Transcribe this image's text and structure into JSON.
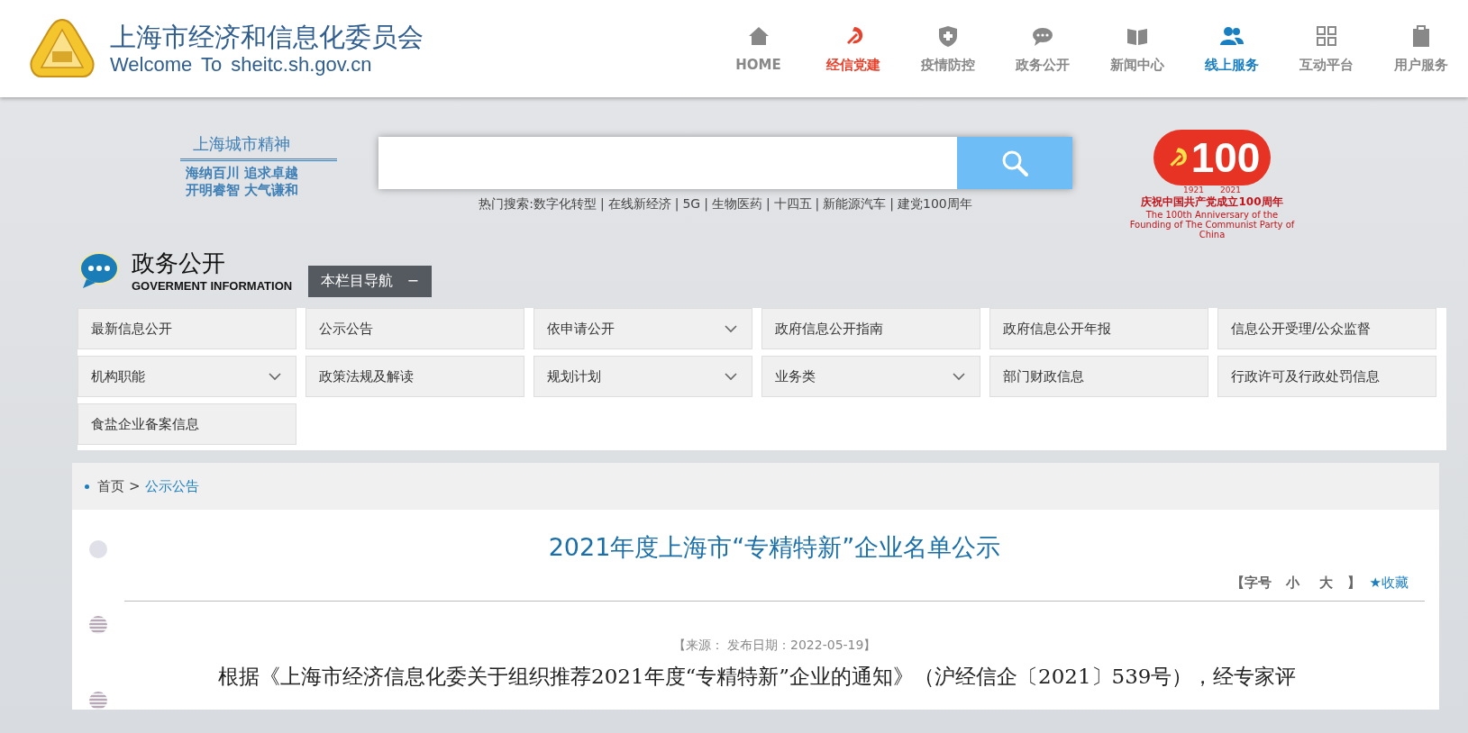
{
  "header": {
    "title": "上海市经济和信息化委员会",
    "subtitle": "Welcome To sheitc.sh.gov.cn"
  },
  "nav": [
    {
      "label": "HOME",
      "color": "#888888"
    },
    {
      "label": "经信党建",
      "color": "#e8412c"
    },
    {
      "label": "疫情防控",
      "color": "#888888"
    },
    {
      "label": "政务公开",
      "color": "#888888"
    },
    {
      "label": "新闻中心",
      "color": "#888888"
    },
    {
      "label": "线上服务",
      "color": "#1a7fc1"
    },
    {
      "label": "互动平台",
      "color": "#888888"
    },
    {
      "label": "用户服务",
      "color": "#888888"
    }
  ],
  "motto": {
    "title": "上海城市精神",
    "lines": [
      "海纳百川 追求卓越",
      "开明睿智 大气谦和"
    ]
  },
  "search": {
    "hot_label": "热门搜索:",
    "separator": "|",
    "hot_terms": [
      "数字化转型",
      "在线新经济",
      "5G",
      "生物医药",
      "十四五",
      "新能源汽车",
      "建党100周年"
    ]
  },
  "anniversary": {
    "number": "100",
    "years": [
      "1921",
      "2021"
    ],
    "caption": "庆祝中国共产党成立100周年",
    "english": "The 100th Anniversary of the Founding of The Communist Party of China"
  },
  "section": {
    "title": "政务公开",
    "subtitle": "GOVERMENT INFORMATION",
    "nav_button": "本栏目导航",
    "toggle": "−"
  },
  "menu": [
    {
      "label": "最新信息公开",
      "expandable": false
    },
    {
      "label": "公示公告",
      "expandable": false
    },
    {
      "label": "依申请公开",
      "expandable": true
    },
    {
      "label": "政府信息公开指南",
      "expandable": false
    },
    {
      "label": "政府信息公开年报",
      "expandable": false
    },
    {
      "label": "信息公开受理/公众监督",
      "expandable": false
    },
    {
      "label": "机构职能",
      "expandable": true
    },
    {
      "label": "政策法规及解读",
      "expandable": false
    },
    {
      "label": "规划计划",
      "expandable": true
    },
    {
      "label": "业务类",
      "expandable": true
    },
    {
      "label": "部门财政信息",
      "expandable": false
    },
    {
      "label": "行政许可及行政处罚信息",
      "expandable": false
    },
    {
      "label": "食盐企业备案信息",
      "expandable": false
    }
  ],
  "breadcrumb": [
    {
      "label": "首页",
      "current": false
    },
    {
      "label": "公示公告",
      "current": true
    }
  ],
  "breadcrumb_separator": ">",
  "article": {
    "title": "2021年度上海市“专精特新”企业名单公示",
    "font_size_label": "【字号",
    "small": "小",
    "large": "大",
    "bracket_close": "】",
    "favorite": "★收藏",
    "meta": "【来源： 发布日期：2022-05-19】",
    "body": "根据《上海市经济信息化委关于组织推荐2021年度“专精特新”企业的通知》（沪经信企〔2021〕539号），经专家评"
  }
}
